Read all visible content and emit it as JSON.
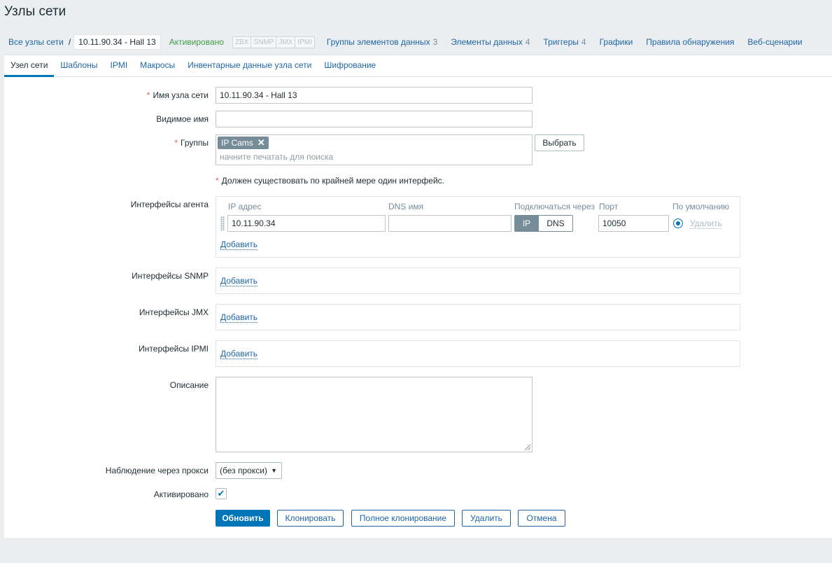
{
  "page": {
    "title": "Узлы сети"
  },
  "breadcrumb": {
    "all_hosts": "Все узлы сети",
    "separator": "/",
    "current": "10.11.90.34 - Hall 13"
  },
  "host_nav": {
    "status": "Активировано",
    "availability": [
      "ZBX",
      "SNMP",
      "JMX",
      "IPMI"
    ],
    "links": [
      {
        "label": "Группы элементов данных",
        "count": "3"
      },
      {
        "label": "Элементы данных",
        "count": "4"
      },
      {
        "label": "Триггеры",
        "count": "4"
      },
      {
        "label": "Графики",
        "count": ""
      },
      {
        "label": "Правила обнаружения",
        "count": ""
      },
      {
        "label": "Веб-сценарии",
        "count": ""
      }
    ]
  },
  "tabs": [
    "Узел сети",
    "Шаблоны",
    "IPMI",
    "Макросы",
    "Инвентарные данные узла сети",
    "Шифрование"
  ],
  "form": {
    "required_mark": "*",
    "host_name": {
      "label": "Имя узла сети",
      "value": "10.11.90.34 - Hall 13"
    },
    "visible_name": {
      "label": "Видимое имя",
      "value": ""
    },
    "groups": {
      "label": "Группы",
      "selected": "IP Cams",
      "placeholder": "начните печатать для поиска",
      "select_button": "Выбрать"
    },
    "interface_warning": "Должен существовать по крайней мере один интерфейс.",
    "agent_interfaces": {
      "label": "Интерфейсы агента",
      "headers": {
        "ip": "IP адрес",
        "dns": "DNS имя",
        "connect": "Подключаться через",
        "port": "Порт",
        "default": "По умолчанию"
      },
      "row": {
        "ip": "10.11.90.34",
        "dns": "",
        "connect_ip": "IP",
        "connect_dns": "DNS",
        "port": "10050",
        "remove": "Удалить"
      },
      "add": "Добавить"
    },
    "snmp_interfaces": {
      "label": "Интерфейсы SNMP",
      "add": "Добавить"
    },
    "jmx_interfaces": {
      "label": "Интерфейсы JMX",
      "add": "Добавить"
    },
    "ipmi_interfaces": {
      "label": "Интерфейсы IPMI",
      "add": "Добавить"
    },
    "description": {
      "label": "Описание",
      "value": ""
    },
    "proxy": {
      "label": "Наблюдение через прокси",
      "value": "(без прокси)"
    },
    "enabled": {
      "label": "Активировано",
      "checked": true
    }
  },
  "buttons": {
    "update": "Обновить",
    "clone": "Клонировать",
    "full_clone": "Полное клонирование",
    "delete": "Удалить",
    "cancel": "Отмена"
  },
  "colors": {
    "link": "#1f65a6",
    "primary": "#0275b8",
    "enabled": "#429e47",
    "required": "#e45959",
    "background": "#ebeef0"
  }
}
